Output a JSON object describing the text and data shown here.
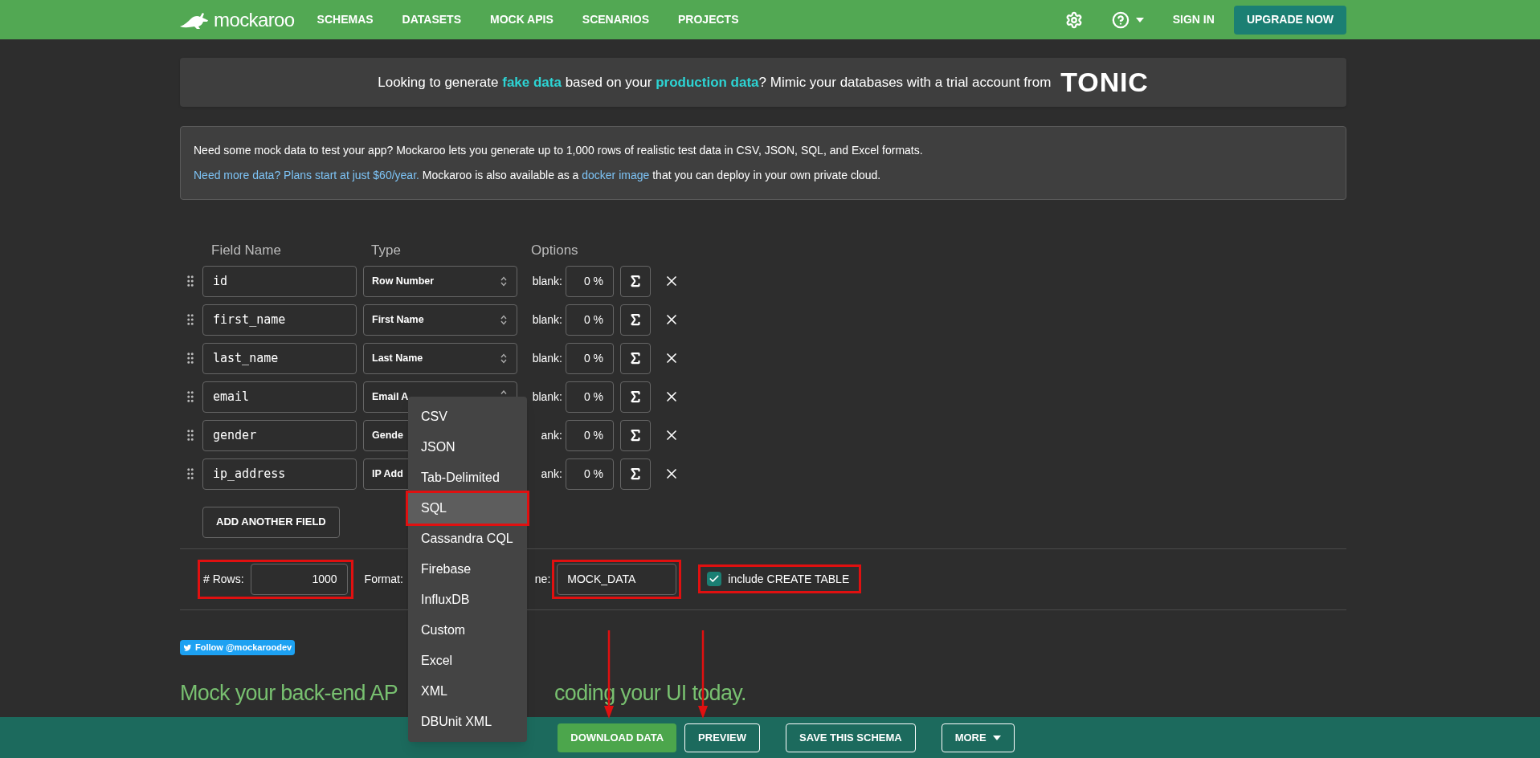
{
  "nav": {
    "logo": "mockaroo",
    "items": [
      "SCHEMAS",
      "DATASETS",
      "MOCK APIS",
      "SCENARIOS",
      "PROJECTS"
    ],
    "sign_in": "SIGN IN",
    "upgrade": "UPGRADE NOW"
  },
  "banner": {
    "segments": [
      {
        "text": "Looking to generate ",
        "kind": "plain"
      },
      {
        "text": "fake data",
        "kind": "highlight"
      },
      {
        "text": " based on your ",
        "kind": "plain"
      },
      {
        "text": "production data",
        "kind": "highlight"
      },
      {
        "text": "? Mimic your databases with a trial account from",
        "kind": "plain"
      }
    ],
    "brand": "TONIC"
  },
  "info": {
    "line1": "Need some mock data to test your app? Mockaroo lets you generate up to 1,000 rows of realistic test data in CSV, JSON, SQL, and Excel formats.",
    "line2": [
      {
        "text": "Need more data? Plans start at just $60/year.",
        "kind": "link"
      },
      {
        "text": " Mockaroo is also available as a ",
        "kind": "plain"
      },
      {
        "text": "docker image",
        "kind": "link"
      },
      {
        "text": " that you can deploy in your own private cloud.",
        "kind": "plain"
      }
    ]
  },
  "columns": [
    "Field Name",
    "Type",
    "Options"
  ],
  "fields": [
    {
      "name": "id",
      "type": "Row Number",
      "kind": "open",
      "blank_label": "blank:",
      "blank": "0 %"
    },
    {
      "name": "first_name",
      "type": "First Name",
      "kind": "open",
      "blank_label": "blank:",
      "blank": "0 %"
    },
    {
      "name": "last_name",
      "type": "Last Name",
      "kind": "open",
      "blank_label": "blank:",
      "blank": "0 %"
    },
    {
      "name": "email",
      "type": "Email A",
      "kind": "clipped",
      "blank_label": "blank:",
      "blank": "0 %"
    },
    {
      "name": "gender",
      "type": "Gende",
      "kind": "covered",
      "blank_label": "ank:",
      "blank": "0 %"
    },
    {
      "name": "ip_address",
      "type": "IP Add",
      "kind": "covered",
      "blank_label": "ank:",
      "blank": "0 %"
    }
  ],
  "add_field": "ADD ANOTHER FIELD",
  "options": {
    "rows_label": "# Rows:",
    "rows": "1000",
    "format_label": "Format:",
    "table_label": "ne:",
    "table_name": "MOCK_DATA",
    "include_create": {
      "checked": true,
      "label": "include CREATE TABLE"
    }
  },
  "format_menu": [
    {
      "label": "CSV",
      "selected": false
    },
    {
      "label": "JSON",
      "selected": false
    },
    {
      "label": "Tab-Delimited",
      "selected": false
    },
    {
      "label": "SQL",
      "selected": true
    },
    {
      "label": "Cassandra CQL",
      "selected": false
    },
    {
      "label": "Firebase",
      "selected": false
    },
    {
      "label": "InfluxDB",
      "selected": false
    },
    {
      "label": "Custom",
      "selected": false
    },
    {
      "label": "Excel",
      "selected": false
    },
    {
      "label": "XML",
      "selected": false
    },
    {
      "label": "DBUnit XML",
      "selected": false
    }
  ],
  "follow": "Follow @mockaroodev",
  "headline": [
    "Mock your back-end AP",
    "coding your UI today."
  ],
  "bottom_bar": [
    {
      "label": "DOWNLOAD DATA",
      "kind": "primary"
    },
    {
      "label": "PREVIEW",
      "kind": "outline"
    },
    {
      "label": "SAVE THIS SCHEMA",
      "kind": "outline"
    },
    {
      "label": "MORE",
      "kind": "menu"
    }
  ]
}
